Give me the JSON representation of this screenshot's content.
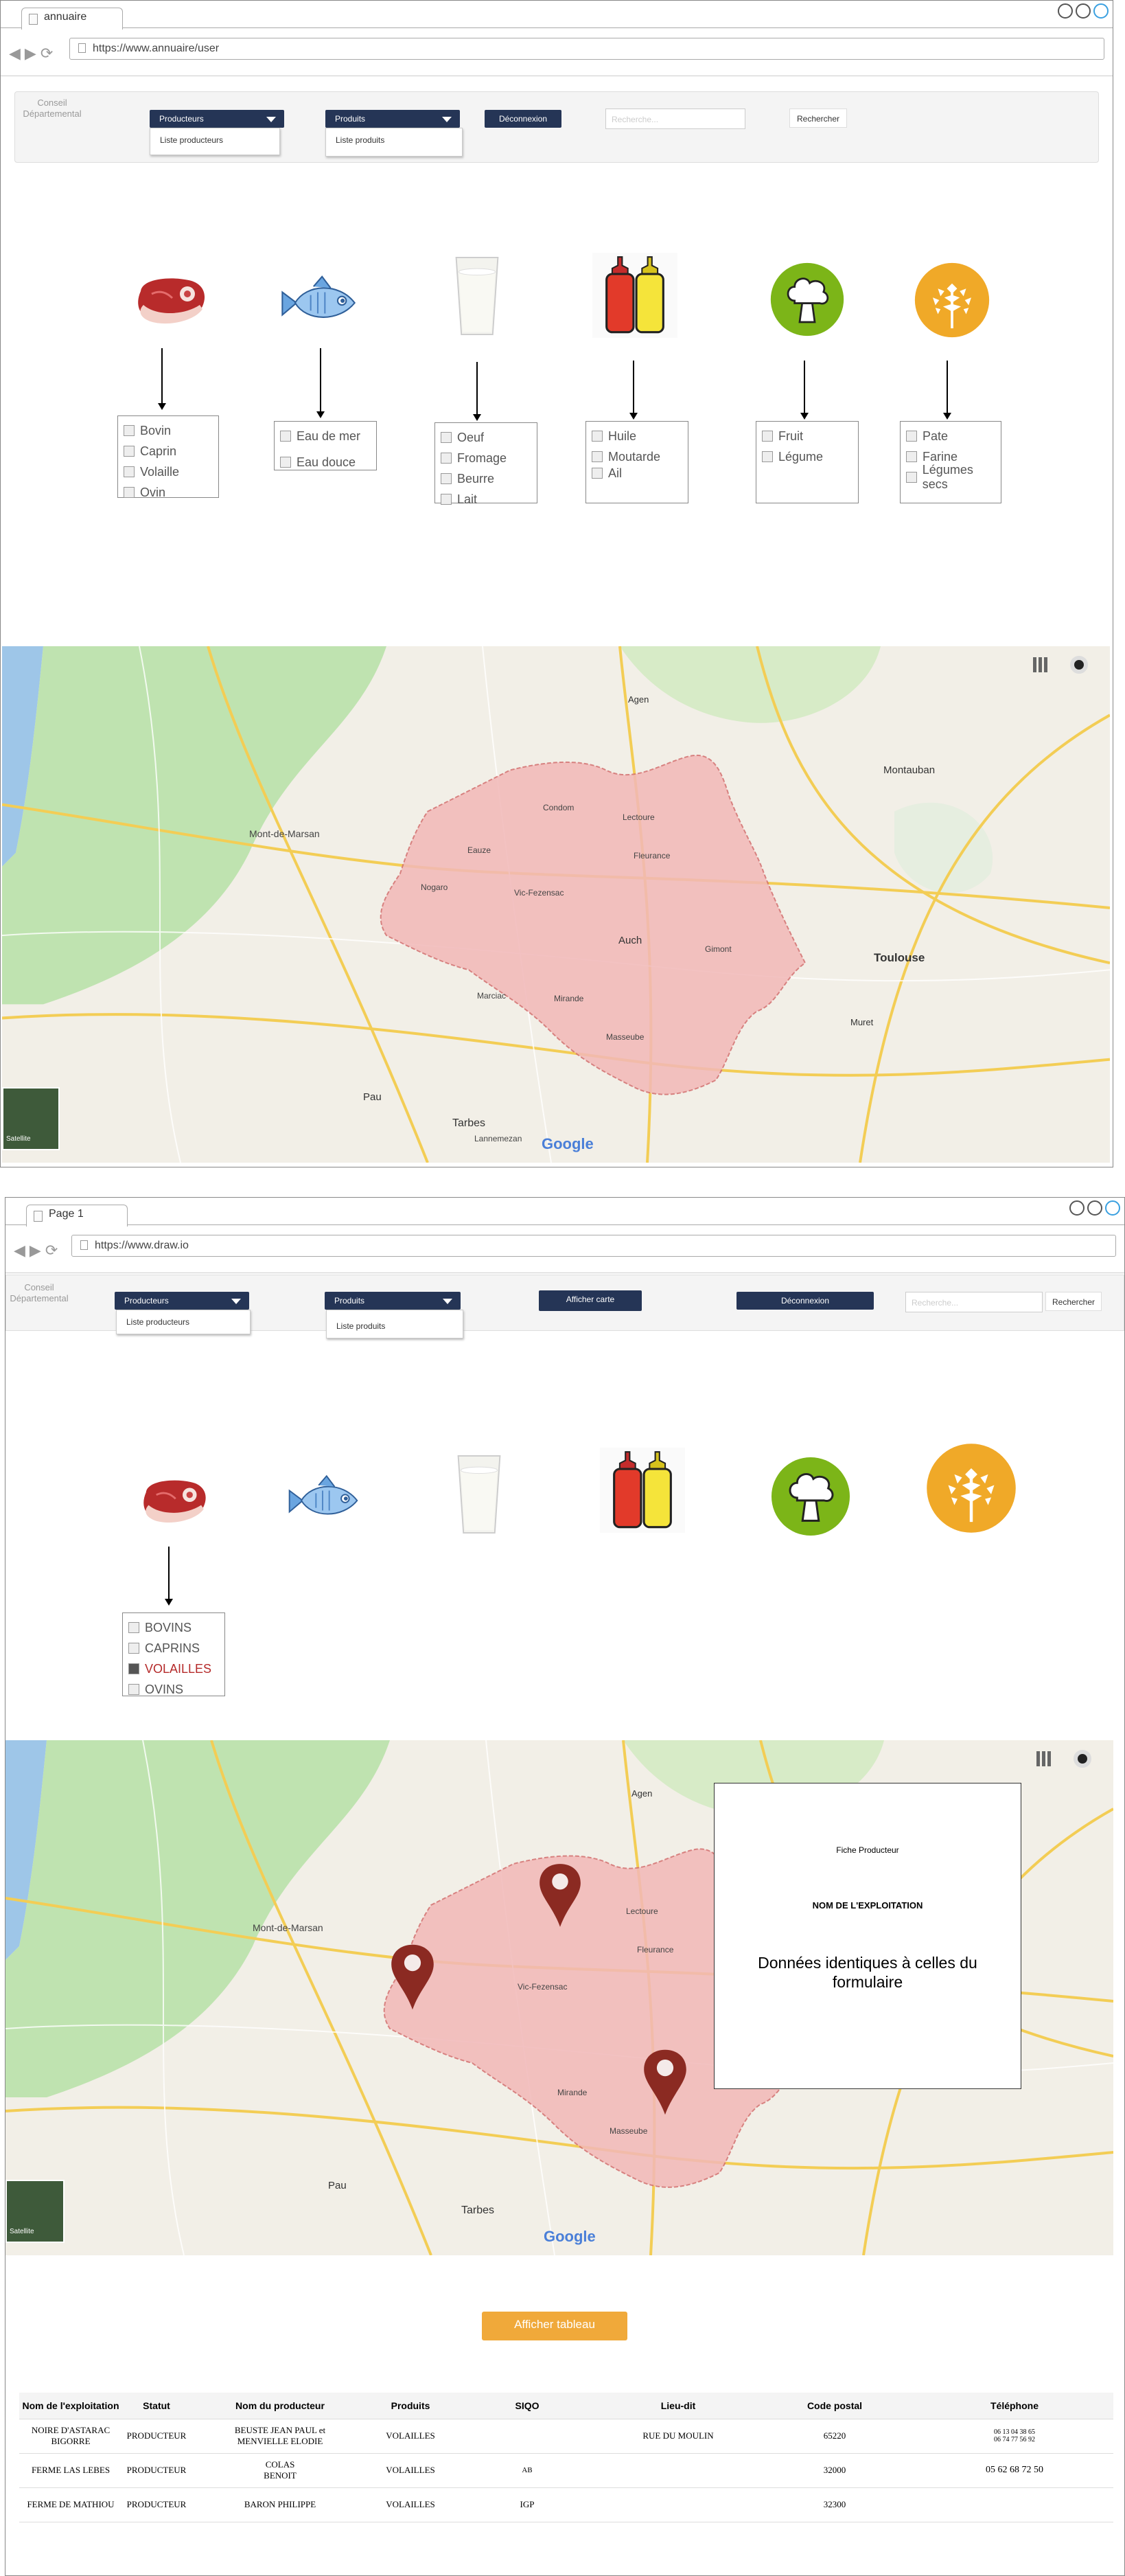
{
  "window1": {
    "tab_title": "annuaire",
    "url": "https://www.annuaire/user",
    "logo": "Conseil\nDépartemental",
    "producers_dropdown": "Producteurs",
    "producers_menu_item": "Liste producteurs",
    "products_dropdown": "Produits",
    "products_menu_item": "Liste produits",
    "logout_button": "Déconnexion",
    "search_placeholder": "Recherche...",
    "search_button": "Rechercher",
    "categories": [
      {
        "icon": "meat-icon",
        "options": [
          "Bovin",
          "Caprin",
          "Volaille",
          "Ovin"
        ]
      },
      {
        "icon": "fish-icon",
        "options": [
          "Eau de mer",
          "Eau douce"
        ]
      },
      {
        "icon": "milk-glass-icon",
        "options": [
          "Oeuf",
          "Fromage",
          "Beurre",
          "Lait"
        ]
      },
      {
        "icon": "condiment-bottles-icon",
        "options": [
          "Huile",
          "Moutarde",
          "Ail"
        ]
      },
      {
        "icon": "broccoli-icon",
        "options": [
          "Fruit",
          "Légume"
        ]
      },
      {
        "icon": "wheat-icon",
        "options": [
          "Pate",
          "Farine",
          "Légumes secs"
        ]
      }
    ]
  },
  "map_labels": {
    "towns": [
      "Mont-de-Marsan",
      "Condom",
      "Lectoure",
      "Eauze",
      "Nogaro",
      "Vic-Fezensac",
      "Fleurance",
      "Auch",
      "Gimont",
      "Toulouse",
      "Mirande",
      "Masseube",
      "Pau",
      "Tarbes",
      "Montauban",
      "Agen",
      "Muret",
      "Marciac",
      "Lannemezan"
    ],
    "satellite_label": "Satellite",
    "brand": "Google"
  },
  "window2": {
    "tab_title": "Page 1",
    "url": "https://www.draw.io",
    "logo": "Conseil\nDépartemental",
    "producers_dropdown": "Producteurs",
    "producers_menu_item": "Liste producteurs",
    "products_dropdown": "Produits",
    "products_menu_item": "Liste produits",
    "show_map_button": "Afficher carte",
    "logout_button": "Déconnexion",
    "search_placeholder": "Recherche...",
    "search_button": "Rechercher",
    "category_icons": [
      "meat-icon",
      "fish-icon",
      "milk-glass-icon",
      "condiment-bottles-icon",
      "broccoli-icon",
      "wheat-icon"
    ],
    "meat_options": [
      {
        "label": "BOVINS",
        "checked": false
      },
      {
        "label": "CAPRINS",
        "checked": false
      },
      {
        "label": "VOLAILLES",
        "checked": true
      },
      {
        "label": "OVINS",
        "checked": false
      }
    ],
    "popup": {
      "title": "Fiche Producteur",
      "farm_name": "NOM DE L'EXPLOITATION",
      "body": "Données identiques à celles du formulaire"
    },
    "show_table_button": "Afficher tableau",
    "table": {
      "headers": [
        "Nom de l'exploitation",
        "Statut",
        "Nom du producteur",
        "Produits",
        "SIQO",
        "Lieu-dit",
        "Code postal",
        "Téléphone"
      ],
      "rows": [
        [
          "NOIRE D'ASTARAC BIGORRE",
          "PRODUCTEUR",
          "BEUSTE JEAN PAUL et MENVIELLE ELODIE",
          "VOLAILLES",
          "",
          "RUE DU MOULIN",
          "65220",
          "06 13 04 38 65\n06 74 77 56 92"
        ],
        [
          "FERME LAS LEBES",
          "PRODUCTEUR",
          "COLAS\nBENOIT",
          "VOLAILLES",
          "AB",
          "",
          "32000",
          "05 62 68 72 50"
        ],
        [
          "FERME DE MATHIOU",
          "PRODUCTEUR",
          "BARON PHILIPPE",
          "VOLAILLES",
          "IGP",
          "",
          "32300",
          ""
        ]
      ]
    }
  },
  "colors": {
    "navy": "#253556",
    "orange": "#f0a93a",
    "pin": "#8b2a22",
    "region": "#f2b8b8"
  }
}
